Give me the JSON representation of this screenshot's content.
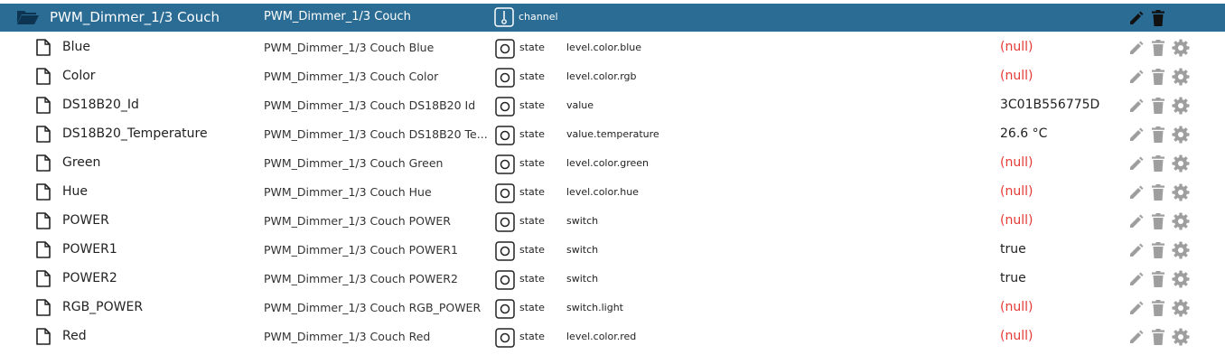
{
  "channel": {
    "name": "PWM_Dimmer_1/3 Couch",
    "title": "PWM_Dimmer_1/3 Couch",
    "type": "channel",
    "icon": "folder-open-icon"
  },
  "states": [
    {
      "name": "Blue",
      "title": "PWM_Dimmer_1/3 Couch Blue",
      "type": "state",
      "role": "level.color.blue",
      "value": "(null)",
      "is_null": true
    },
    {
      "name": "Color",
      "title": "PWM_Dimmer_1/3 Couch Color",
      "type": "state",
      "role": "level.color.rgb",
      "value": "(null)",
      "is_null": true
    },
    {
      "name": "DS18B20_Id",
      "title": "PWM_Dimmer_1/3 Couch DS18B20 Id",
      "type": "state",
      "role": "value",
      "value": "3C01B556775D",
      "is_null": false
    },
    {
      "name": "DS18B20_Temperature",
      "title": "PWM_Dimmer_1/3 Couch DS18B20 Te...",
      "type": "state",
      "role": "value.temperature",
      "value": "26.6 °C",
      "is_null": false
    },
    {
      "name": "Green",
      "title": "PWM_Dimmer_1/3 Couch Green",
      "type": "state",
      "role": "level.color.green",
      "value": "(null)",
      "is_null": true
    },
    {
      "name": "Hue",
      "title": "PWM_Dimmer_1/3 Couch Hue",
      "type": "state",
      "role": "level.color.hue",
      "value": "(null)",
      "is_null": true
    },
    {
      "name": "POWER",
      "title": "PWM_Dimmer_1/3 Couch POWER",
      "type": "state",
      "role": "switch",
      "value": "(null)",
      "is_null": true
    },
    {
      "name": "POWER1",
      "title": "PWM_Dimmer_1/3 Couch POWER1",
      "type": "state",
      "role": "switch",
      "value": "true",
      "is_null": false
    },
    {
      "name": "POWER2",
      "title": "PWM_Dimmer_1/3 Couch POWER2",
      "type": "state",
      "role": "switch",
      "value": "true",
      "is_null": false
    },
    {
      "name": "RGB_POWER",
      "title": "PWM_Dimmer_1/3 Couch RGB_POWER",
      "type": "state",
      "role": "switch.light",
      "value": "(null)",
      "is_null": true
    },
    {
      "name": "Red",
      "title": "PWM_Dimmer_1/3 Couch Red",
      "type": "state",
      "role": "level.color.red",
      "value": "(null)",
      "is_null": true
    }
  ],
  "colors": {
    "header_bg": "#2b6c94",
    "null_value": "#e53935",
    "action_icon": "#9e9e9e",
    "action_icon_header": "#111111"
  }
}
